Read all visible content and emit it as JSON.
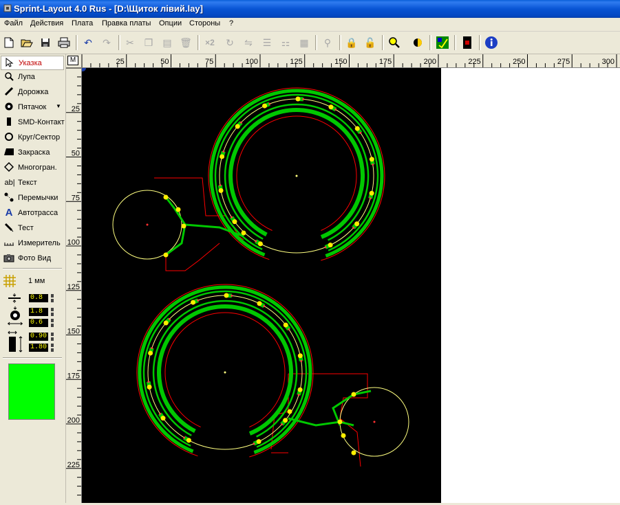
{
  "window": {
    "title": "Sprint-Layout 4.0 Rus - [D:\\Щиток лівий.lay]"
  },
  "menu": [
    "Файл",
    "Действия",
    "Плата",
    "Правка платы",
    "Опции",
    "Стороны",
    "?"
  ],
  "toolbar": {
    "buttons": [
      "new-icon",
      "open-icon",
      "save-icon",
      "print-icon",
      "undo-icon",
      "redo-icon",
      "cut-icon",
      "copy-icon",
      "paste-icon",
      "delete-icon",
      "duplicate-icon",
      "rotate-icon",
      "mirror-icon",
      "align-icon",
      "group-icon",
      "arrange-icon",
      "lock-icon",
      "unlock-icon",
      "zoom-icon",
      "layer-toggle-icon",
      "drc-icon",
      "macro-icon",
      "info-icon"
    ],
    "x2_label": "×2"
  },
  "tools": [
    {
      "label": "Указка",
      "icon": "pointer-icon",
      "active": true
    },
    {
      "label": "Лупа",
      "icon": "magnifier-icon"
    },
    {
      "label": "Дорожка",
      "icon": "track-icon"
    },
    {
      "label": "Пятачок",
      "icon": "pad-icon",
      "dropdown": true
    },
    {
      "label": "SMD-Контакт",
      "icon": "smd-pad-icon"
    },
    {
      "label": "Круг/Сектор",
      "icon": "circle-icon"
    },
    {
      "label": "Закраска",
      "icon": "fill-icon"
    },
    {
      "label": "Многогран.",
      "icon": "polygon-icon"
    },
    {
      "label": "Текст",
      "icon": "text-icon",
      "icon_text": "ab|"
    },
    {
      "label": "Перемычки",
      "icon": "jumper-icon"
    },
    {
      "label": "Автотрасса",
      "icon": "autoroute-icon",
      "icon_text": "A"
    },
    {
      "label": "Тест",
      "icon": "test-icon"
    },
    {
      "label": "Измеритель",
      "icon": "measure-icon"
    },
    {
      "label": "Фото Вид",
      "icon": "camera-icon"
    }
  ],
  "grid": {
    "label": "1 мм"
  },
  "params": {
    "track_width": "0.8",
    "pad_outer": "1.8",
    "pad_inner": "0.6",
    "smd_w": "0.90",
    "smd_h": "1.80"
  },
  "layer_color": "#00ff00",
  "ruler": {
    "corner": "M",
    "top": [
      "25",
      "50",
      "75",
      "100",
      "125",
      "150",
      "175",
      "200",
      "225",
      "250",
      "275",
      "300"
    ],
    "left": [
      "25",
      "50",
      "75",
      "100",
      "125",
      "150",
      "175",
      "200",
      "225"
    ]
  },
  "colors": {
    "board": "#000000",
    "track": "#00c800",
    "outline": "#ff0000",
    "silk": "#ffff80",
    "pad": "#ffee00"
  }
}
